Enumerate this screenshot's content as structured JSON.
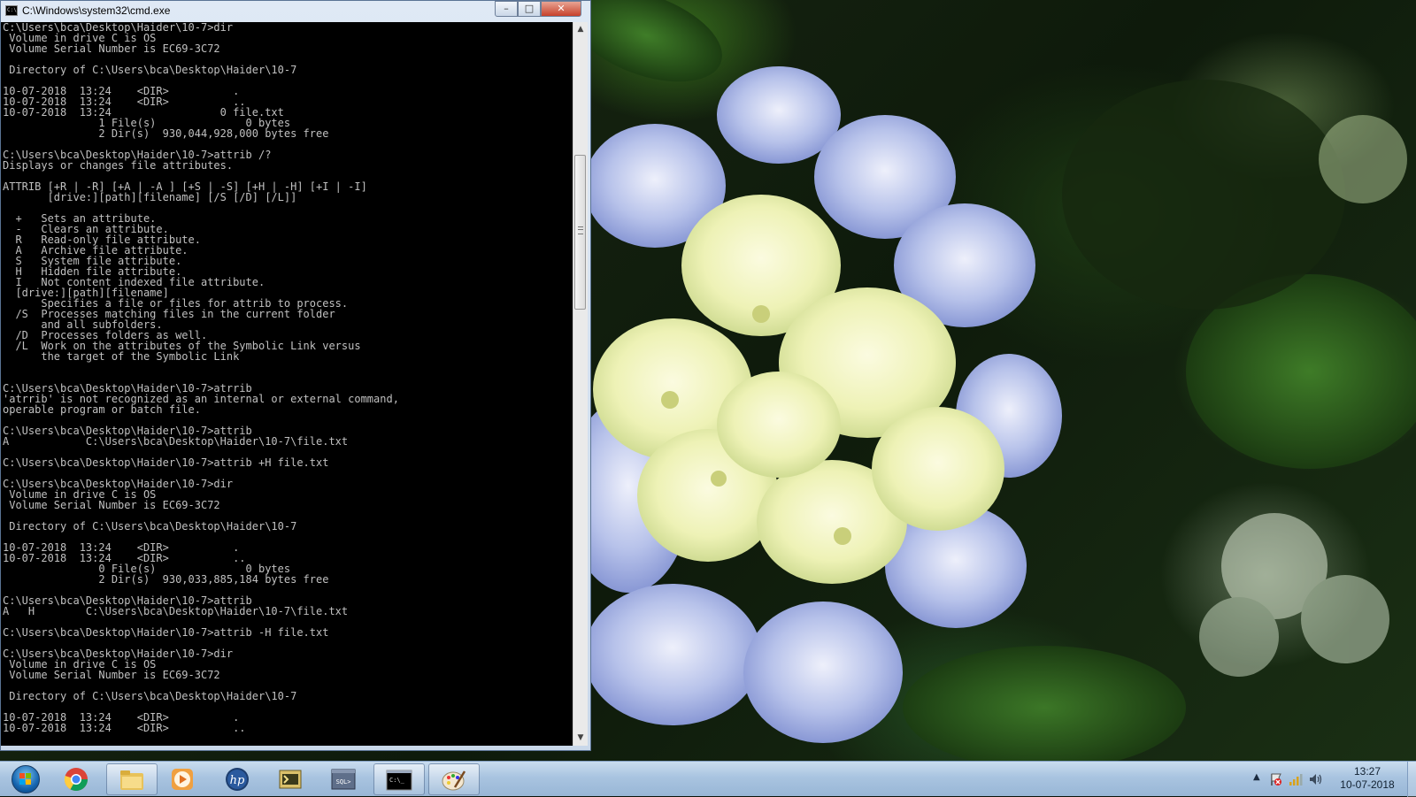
{
  "window": {
    "title": "C:\\Windows\\system32\\cmd.exe",
    "icon_text": "C:\\",
    "min_glyph": "–",
    "max_glyph": "□",
    "close_glyph": "✕"
  },
  "console": {
    "lines": [
      "C:\\Users\\bca\\Desktop\\Haider\\10-7>dir",
      " Volume in drive C is OS",
      " Volume Serial Number is EC69-3C72",
      "",
      " Directory of C:\\Users\\bca\\Desktop\\Haider\\10-7",
      "",
      "10-07-2018  13:24    <DIR>          .",
      "10-07-2018  13:24    <DIR>          ..",
      "10-07-2018  13:24                 0 file.txt",
      "               1 File(s)              0 bytes",
      "               2 Dir(s)  930,044,928,000 bytes free",
      "",
      "C:\\Users\\bca\\Desktop\\Haider\\10-7>attrib /?",
      "Displays or changes file attributes.",
      "",
      "ATTRIB [+R | -R] [+A | -A ] [+S | -S] [+H | -H] [+I | -I]",
      "       [drive:][path][filename] [/S [/D] [/L]]",
      "",
      "  +   Sets an attribute.",
      "  -   Clears an attribute.",
      "  R   Read-only file attribute.",
      "  A   Archive file attribute.",
      "  S   System file attribute.",
      "  H   Hidden file attribute.",
      "  I   Not content indexed file attribute.",
      "  [drive:][path][filename]",
      "      Specifies a file or files for attrib to process.",
      "  /S  Processes matching files in the current folder",
      "      and all subfolders.",
      "  /D  Processes folders as well.",
      "  /L  Work on the attributes of the Symbolic Link versus",
      "      the target of the Symbolic Link",
      "",
      "",
      "C:\\Users\\bca\\Desktop\\Haider\\10-7>atrrib",
      "'atrrib' is not recognized as an internal or external command,",
      "operable program or batch file.",
      "",
      "C:\\Users\\bca\\Desktop\\Haider\\10-7>attrib",
      "A            C:\\Users\\bca\\Desktop\\Haider\\10-7\\file.txt",
      "",
      "C:\\Users\\bca\\Desktop\\Haider\\10-7>attrib +H file.txt",
      "",
      "C:\\Users\\bca\\Desktop\\Haider\\10-7>dir",
      " Volume in drive C is OS",
      " Volume Serial Number is EC69-3C72",
      "",
      " Directory of C:\\Users\\bca\\Desktop\\Haider\\10-7",
      "",
      "10-07-2018  13:24    <DIR>          .",
      "10-07-2018  13:24    <DIR>          ..",
      "               0 File(s)              0 bytes",
      "               2 Dir(s)  930,033,885,184 bytes free",
      "",
      "C:\\Users\\bca\\Desktop\\Haider\\10-7>attrib",
      "A   H        C:\\Users\\bca\\Desktop\\Haider\\10-7\\file.txt",
      "",
      "C:\\Users\\bca\\Desktop\\Haider\\10-7>attrib -H file.txt",
      "",
      "C:\\Users\\bca\\Desktop\\Haider\\10-7>dir",
      " Volume in drive C is OS",
      " Volume Serial Number is EC69-3C72",
      "",
      " Directory of C:\\Users\\bca\\Desktop\\Haider\\10-7",
      "",
      "10-07-2018  13:24    <DIR>          .",
      "10-07-2018  13:24    <DIR>          .."
    ],
    "background_color": "#000000",
    "text_color": "#c0c0c0"
  },
  "scrollbar": {
    "up_glyph": "▲",
    "down_glyph": "▼"
  },
  "taskbar": {
    "buttons": [
      {
        "name": "chrome",
        "icon": "chrome-icon"
      },
      {
        "name": "explorer",
        "icon": "folder-icon"
      },
      {
        "name": "media-player",
        "icon": "media-player-icon"
      },
      {
        "name": "hp",
        "icon": "hp-icon"
      },
      {
        "name": "terminal-app",
        "icon": "console-app-icon"
      },
      {
        "name": "sql",
        "icon": "sql-icon"
      },
      {
        "name": "cmd",
        "icon": "cmd-icon",
        "active": true
      },
      {
        "name": "paint",
        "icon": "paint-icon"
      }
    ],
    "sql_icon_text": "SQL>",
    "cmd_icon_text": "C:\\_",
    "hp_icon_text": "hp",
    "tray": {
      "chevron": "▲",
      "icons": [
        "action-center-flag-icon",
        "network-signal-icon",
        "volume-icon"
      ]
    },
    "clock": {
      "time": "13:27",
      "date": "10-07-2018"
    },
    "colors": {
      "taskbar": "#a9c4e0",
      "start_orb": "#1565b0"
    }
  }
}
